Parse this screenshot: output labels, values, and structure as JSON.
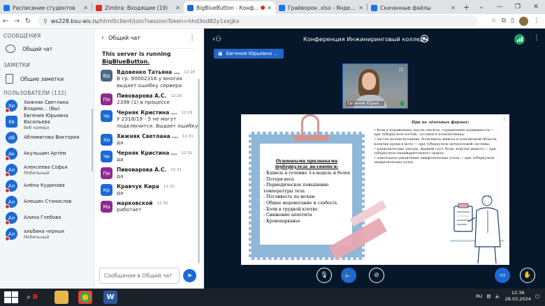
{
  "browser": {
    "tabs": [
      {
        "label": "Расписание студентов",
        "color": "#1a73e8",
        "active": false
      },
      {
        "label": "Zimbra: Входящие (19)",
        "color": "#d93025",
        "active": false
      },
      {
        "label": "BigBlueButton - Конфере",
        "color": "#1b6ad3",
        "active": true
      },
      {
        "label": "Грайворон .xlsx - Яндекс Доку",
        "color": "#1a73e8",
        "active": false
      },
      {
        "label": "Скачанные файлы",
        "color": "#1a73e8",
        "active": false
      }
    ],
    "url_host": "ws228.bsu-eis.ru",
    "url_path": "/html5client/join?sessionToken=hhd3od82y1xxjjkx"
  },
  "sidebar": {
    "messages_header": "СООБЩЕНИЯ",
    "public_chat_label": "Общий чат",
    "notes_header": "ЗАМЕТКИ",
    "shared_notes_label": "Общие заметки",
    "users_header": "ПОЛЬЗОВАТЕЛИ (132)",
    "users": [
      {
        "initials": "Хи",
        "name": "Хижняк Светлана Владми... (Вы)",
        "sub": "",
        "color": "#1b6ad3",
        "muted": true
      },
      {
        "initials": "Ев",
        "name": "Евгения Юрьевна Васильева",
        "sub": "Веб камера",
        "color": "#1b6ad3",
        "muted": false
      },
      {
        "initials": "Аб",
        "name": "Аблямитова Виктория",
        "sub": "",
        "color": "#1b6ad3",
        "muted": false
      },
      {
        "initials": "Ак",
        "name": "Акульшин Артём",
        "sub": "",
        "color": "#1b6ad3",
        "muted": true
      },
      {
        "initials": "Ал",
        "name": "Алексеева Софья",
        "sub": "Мобильный",
        "color": "#1b6ad3",
        "muted": true
      },
      {
        "initials": "Ал",
        "name": "Алёна Кудинова",
        "sub": "",
        "color": "#1b6ad3",
        "muted": true
      },
      {
        "initials": "Ал",
        "name": "Алешин Станислав",
        "sub": "",
        "color": "#1b6ad3",
        "muted": true
      },
      {
        "initials": "Ал",
        "name": "Алина Глебова",
        "sub": "",
        "color": "#1b6ad3",
        "muted": true
      },
      {
        "initials": "Ал",
        "name": "альбина черных",
        "sub": "Мобильный",
        "color": "#1b6ad3",
        "muted": true
      }
    ]
  },
  "chat": {
    "title": "Общий чат",
    "welcome_line": "This server is running",
    "welcome_link": "BigBlueButton.",
    "messages": [
      {
        "initials": "Вд",
        "name": "Вдовенко Татьяна ...",
        "time": "12:28",
        "text": "В гр. 90002316 у многих выдает ошибку сервера",
        "color": "#4a6a88"
      },
      {
        "initials": "Пи",
        "name": "Пивоварова А.С.",
        "time": "12:29",
        "text": "2398 (1) в процессе",
        "color": "#8e2b8f"
      },
      {
        "initials": "Че",
        "name": "Черняк Кристина ...",
        "time": "12:29",
        "text": "У 2318/19 - 5 не могут подключится. Выдает ошибку",
        "color": "#1b6ad3"
      },
      {
        "initials": "Хи",
        "name": "Хижняк Светлана ...",
        "time": "12:31",
        "text": "да",
        "color": "#1b6ad3"
      },
      {
        "initials": "Че",
        "name": "Черняк Кристина ...",
        "time": "12:31",
        "text": "да",
        "color": "#1b6ad3"
      },
      {
        "initials": "Пи",
        "name": "Пивоварова А.С.",
        "time": "12:31",
        "text": "да",
        "color": "#8e2b8f"
      },
      {
        "initials": "Кр",
        "name": "Кравчук Кира",
        "time": "12:31",
        "text": "да",
        "color": "#1b6ad3"
      },
      {
        "initials": "Ма",
        "name": "марковской",
        "time": "12:32",
        "text": "работает",
        "color": "#8e2b8f"
      }
    ],
    "input_placeholder": "Сообщение в Общий чат"
  },
  "conference": {
    "title": "Конференция Инжиниринговый колледж",
    "presenter": "Евгения Юрьевна ...",
    "webcam_label": "Евгения Юрье..."
  },
  "slide": {
    "left_title": "Основными признаками туберкулеза являются:",
    "left_items": [
      "- Кашель в течение 3-х недель и более",
      "- Потеря веса",
      "- Периодическое повышение температуры тела",
      "- Потливость по ночам",
      "- Общее недомогание и слабость",
      "- Боли в грудной клетке",
      "- Снижение аппетита",
      "- Кровохарканье"
    ],
    "right_title": "При не лёгочных формах:",
    "right_items": [
      "• боли в пораженных частях скелета, ограничение подвижности — при туберкулезе костей, суставов и позвоночника;",
      "• частое мочеиспускание, боли внизу живота и поясничной области, наличие крови в моче — при туберкулезе мочеполовой системы;",
      "• периодические запоры, жидкий стул, боли, вздутие живота — при туберкулезе пищеварительного тракта;",
      "• длительное увеличение лимфатических узлов — при туберкулезе лимфатических узлов."
    ]
  },
  "taskbar": {
    "lang": "RU",
    "time": "12:36",
    "date": "28.03.2024"
  },
  "colors": {
    "accent": "#1b6ad3",
    "main_bg": "#06172a",
    "sidebar_bg": "#f3f6f9"
  }
}
